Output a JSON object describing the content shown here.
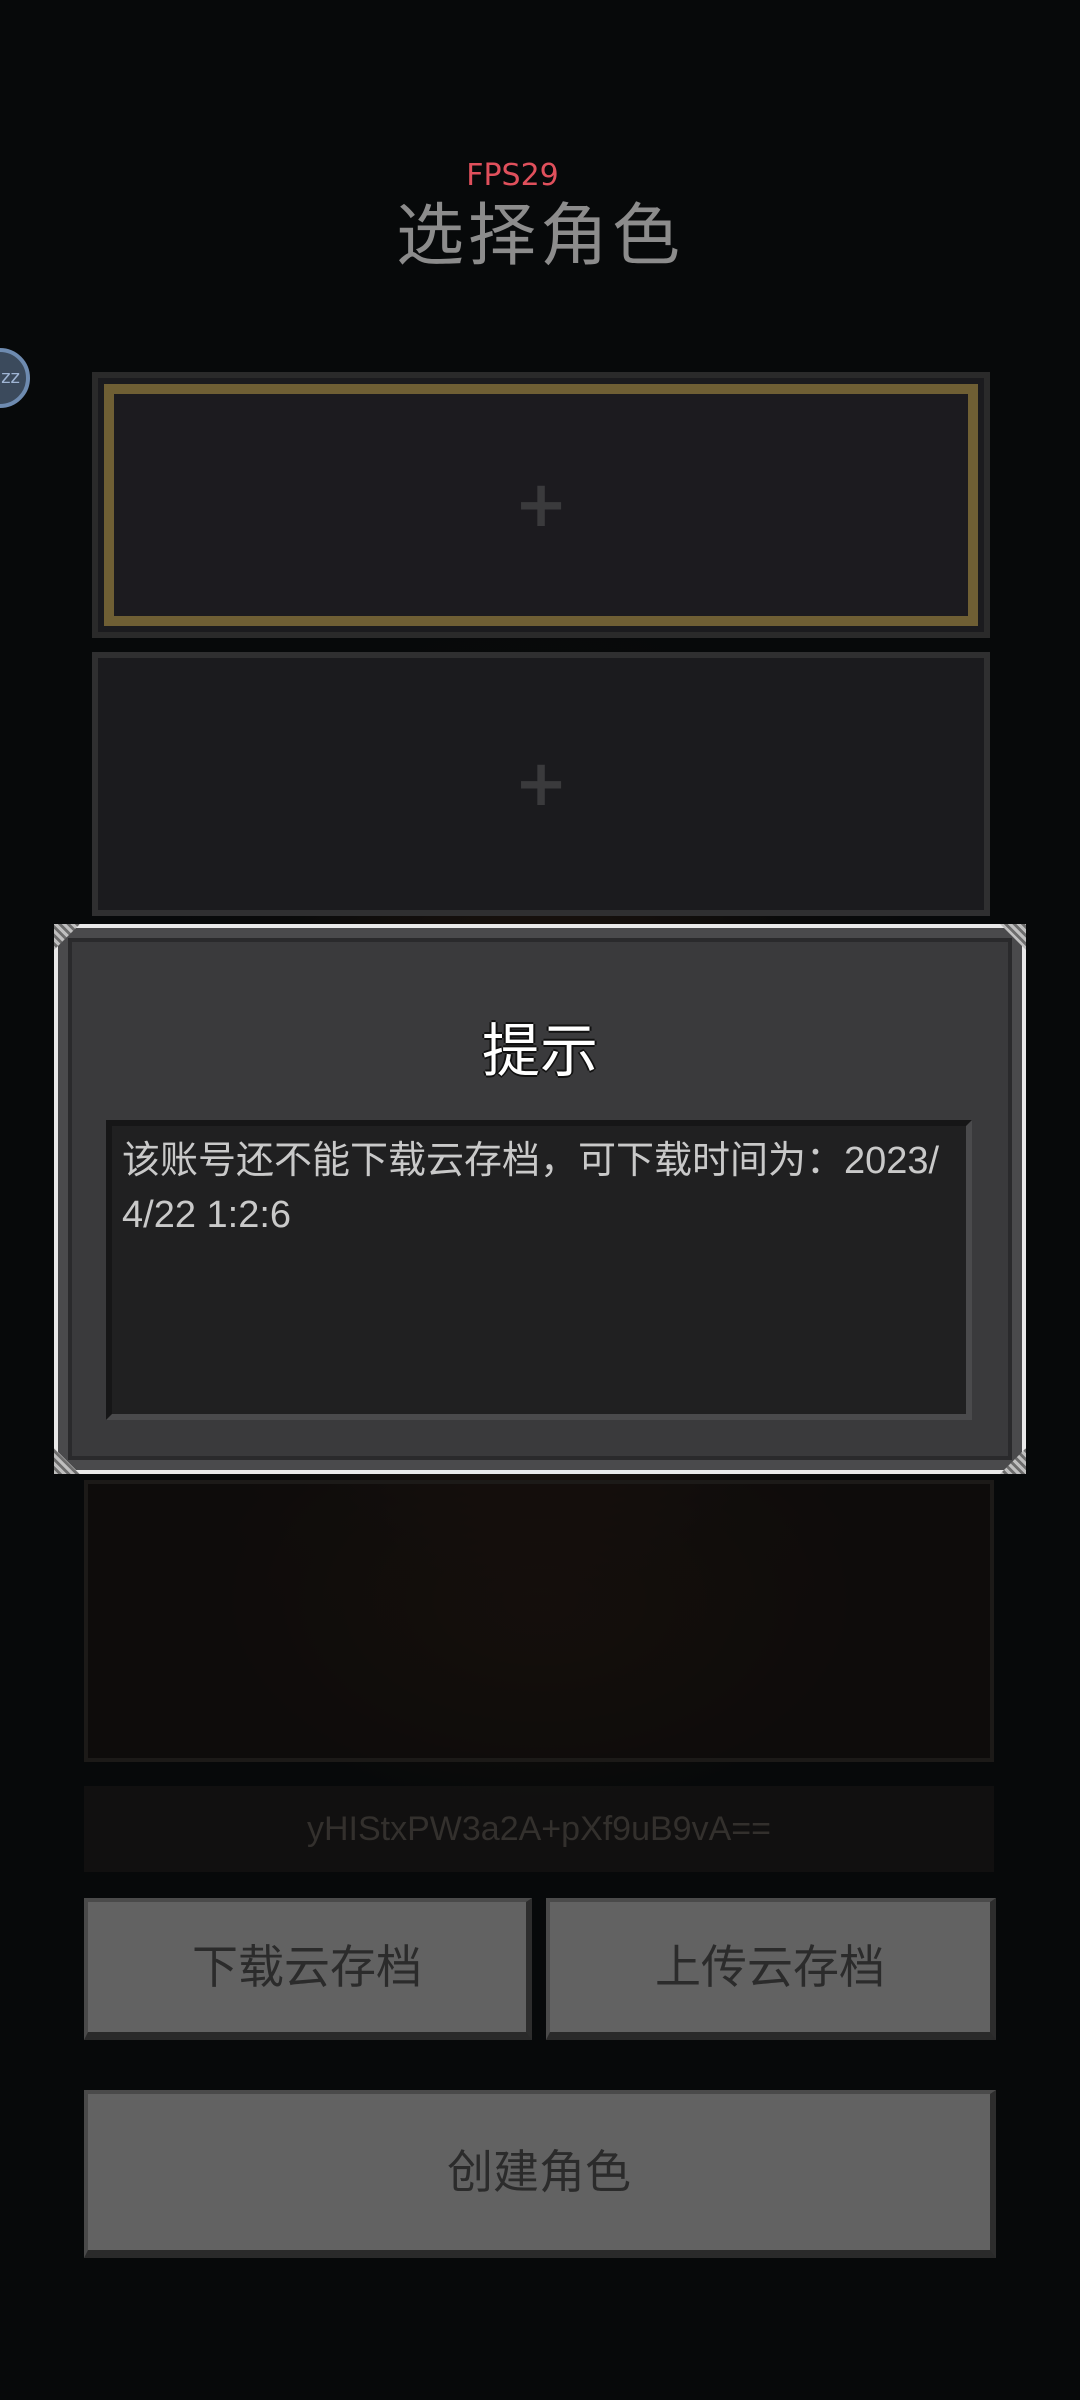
{
  "header": {
    "fps": "FPS29",
    "title": "选择角色",
    "avatar_text": "zz"
  },
  "slots": [
    {
      "label": "+"
    },
    {
      "label": "+"
    }
  ],
  "token_text": "yHIStxPW3a2A+pXf9uB9vA==",
  "buttons": {
    "download": "下载云存档",
    "upload": "上传云存档",
    "create": "创建角色"
  },
  "dialog": {
    "title": "提示",
    "message": "该账号还不能下载云存档，可下载时间为：2023/4/22 1:2:6"
  },
  "colors": {
    "fps": "#e0505c",
    "selected_border": "#6f5f34",
    "button": "#626262"
  }
}
